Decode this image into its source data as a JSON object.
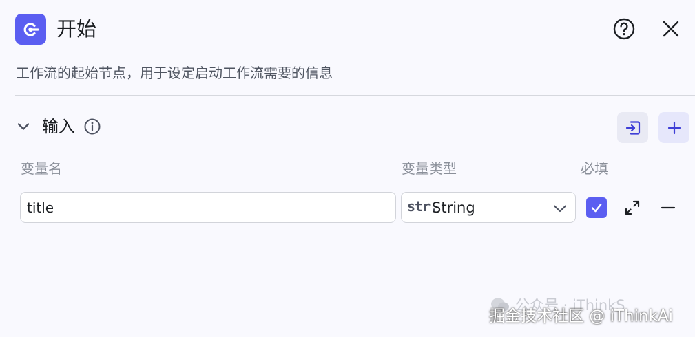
{
  "header": {
    "title": "开始",
    "description": "工作流的起始节点，用于设定启动工作流需要的信息",
    "node_icon": "start-node-icon",
    "help_icon": "question-circle-icon",
    "close_icon": "close-icon"
  },
  "input_section": {
    "title": "输入",
    "info_icon": "info-circle-icon",
    "import_icon": "import-icon",
    "add_icon": "plus-icon",
    "columns": {
      "name": "变量名",
      "type": "变量类型",
      "required": "必填"
    },
    "rows": [
      {
        "name_value": "title",
        "type_prefix": "str.",
        "type_value": "String",
        "required": true
      }
    ]
  },
  "watermark": {
    "line1": "公众号 · iThinkS",
    "line2": "掘金技术社区 @ iThinkAi"
  },
  "colors": {
    "accent": "#5b5ef1",
    "background": "#f9f9fe"
  }
}
